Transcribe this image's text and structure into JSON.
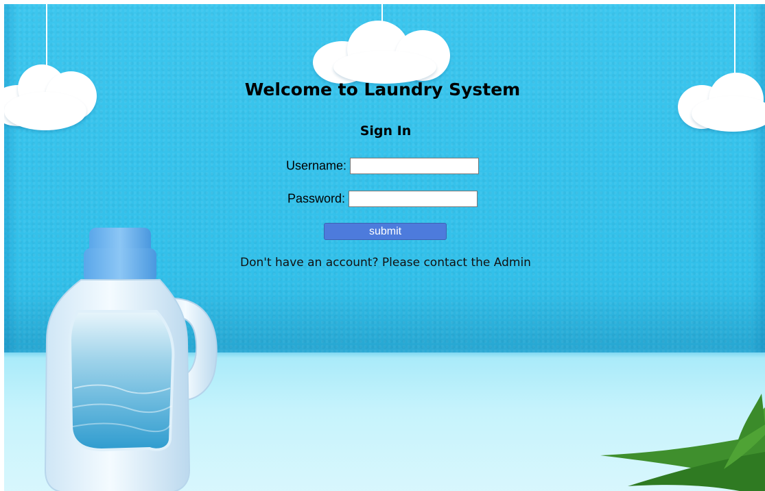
{
  "page": {
    "title": "Welcome to Laundry System",
    "subtitle": "Sign In"
  },
  "form": {
    "username_label": "Username:",
    "username_value": "",
    "password_label": "Password:",
    "password_value": "",
    "submit_label": "submit"
  },
  "footer_note": "Don't have an account? Please contact the Admin",
  "colors": {
    "background_wall": "#3cc6ee",
    "floor": "#c6f3fc",
    "submit_button": "#4d7bdc",
    "text": "#000000"
  },
  "icons": {
    "decoration_bottle": "detergent-bottle-illustration",
    "decoration_clouds": "cloud-illustration",
    "decoration_plant": "palm-leaf-illustration"
  }
}
